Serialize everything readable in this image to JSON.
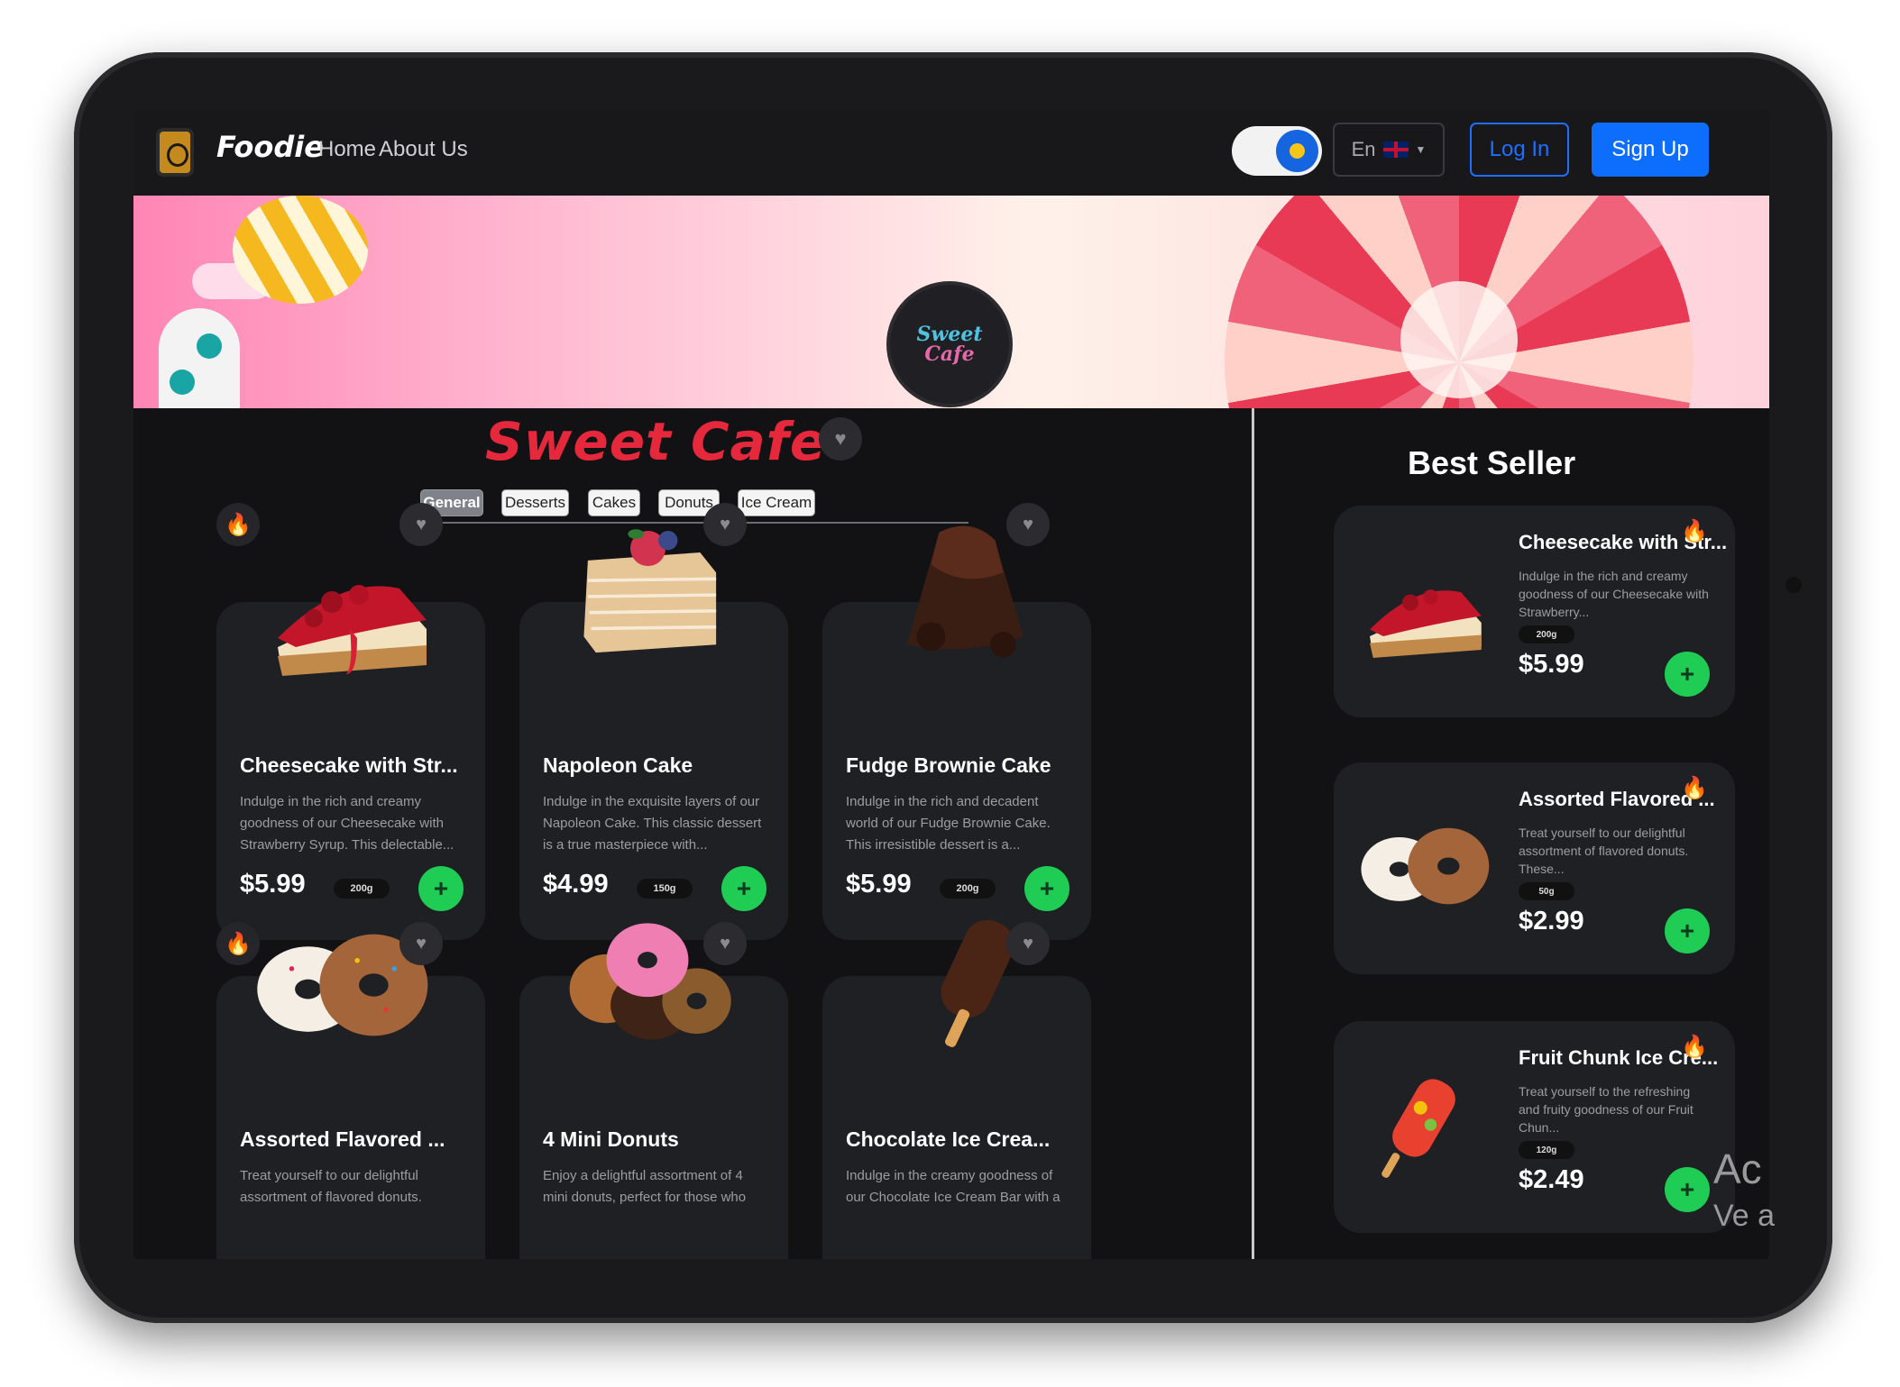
{
  "header": {
    "brand": "Foodie",
    "nav": [
      "Home",
      "About Us"
    ],
    "language": "En",
    "login_label": "Log In",
    "signup_label": "Sign Up"
  },
  "banner": {
    "badge_line1": "Sweet",
    "badge_line2": "Cafe"
  },
  "main": {
    "title": "Sweet Cafe",
    "tabs": [
      "General",
      "Desserts",
      "Cakes",
      "Donuts",
      "Ice Cream"
    ],
    "active_tab": "General",
    "products": [
      {
        "name": "Cheesecake with Str...",
        "desc": "Indulge in the rich and creamy goodness of our Cheesecake with Strawberry Syrup. This delectable...",
        "price": "$5.99",
        "weight": "200g",
        "hot": true
      },
      {
        "name": "Napoleon Cake",
        "desc": "Indulge in the exquisite layers of our Napoleon Cake. This classic dessert is a true masterpiece with...",
        "price": "$4.99",
        "weight": "150g",
        "hot": false
      },
      {
        "name": "Fudge Brownie Cake",
        "desc": "Indulge in the rich and decadent world of our Fudge Brownie Cake. This irresistible dessert is a...",
        "price": "$5.99",
        "weight": "200g",
        "hot": false
      },
      {
        "name": "Assorted Flavored ...",
        "desc": "Treat yourself to our delightful assortment of flavored donuts.",
        "price": "",
        "weight": "",
        "hot": true
      },
      {
        "name": "4 Mini Donuts",
        "desc": "Enjoy a delightful assortment of 4 mini donuts, perfect for those who",
        "price": "",
        "weight": "",
        "hot": false
      },
      {
        "name": "Chocolate Ice Crea...",
        "desc": "Indulge in the creamy goodness of our Chocolate Ice Cream Bar with a",
        "price": "",
        "weight": "",
        "hot": false
      }
    ]
  },
  "best_seller": {
    "title": "Best Seller",
    "items": [
      {
        "name": "Cheesecake with Str...",
        "desc": "Indulge in the rich and creamy goodness of our Cheesecake with Strawberry...",
        "weight": "200g",
        "price": "$5.99"
      },
      {
        "name": "Assorted Flavored ...",
        "desc": "Treat yourself to our delightful assortment of flavored donuts. These...",
        "weight": "50g",
        "price": "$2.99"
      },
      {
        "name": "Fruit Chunk Ice Cre...",
        "desc": "Treat yourself to the refreshing and fruity goodness of our Fruit Chun...",
        "weight": "120g",
        "price": "$2.49"
      }
    ]
  },
  "overlay": {
    "line1": "Ac",
    "line2": "Ve a"
  },
  "colors": {
    "accent_red": "#e5283b",
    "add_green": "#1fcd55",
    "primary_blue": "#0d6efd",
    "fire_orange": "#ff7a1a"
  }
}
